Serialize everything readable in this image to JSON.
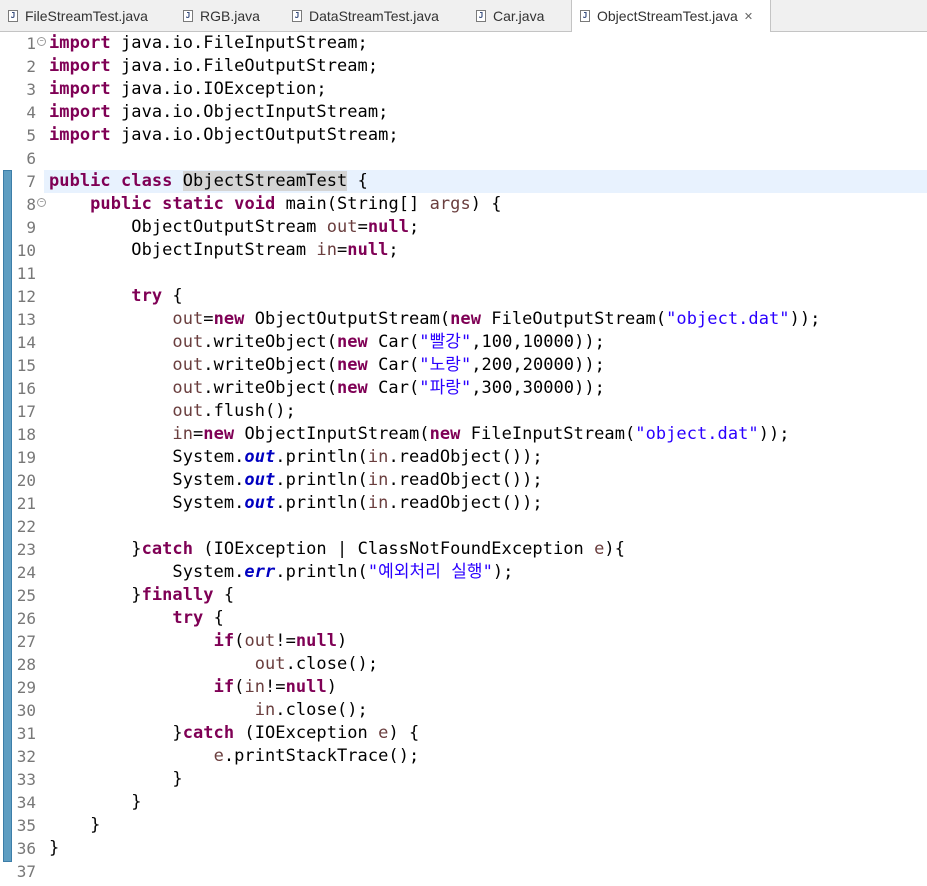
{
  "tabs": [
    {
      "label": "FileStreamTest.java",
      "active": false
    },
    {
      "label": "RGB.java",
      "active": false
    },
    {
      "label": "DataStreamTest.java",
      "active": false
    },
    {
      "label": "Car.java",
      "active": false
    },
    {
      "label": "ObjectStreamTest.java",
      "active": true
    }
  ],
  "colors": {
    "keyword": "#7f0055",
    "string": "#2a00ff",
    "static_field": "#0000c0",
    "local_variable": "#6a3e3e",
    "line_number": "#787878",
    "current_line": "#e8f2fe",
    "ruler": "#5f9ec2"
  },
  "icons": {
    "file_tab": "java-file-icon",
    "close": "close-icon",
    "fold": "fold-collapse-icon"
  },
  "editor": {
    "current_line": 7,
    "fold_markers": [
      1,
      8
    ],
    "lines": [
      [
        {
          "t": "import",
          "c": "kw"
        },
        {
          "t": " java.io.FileInputStream;"
        }
      ],
      [
        {
          "t": "import",
          "c": "kw"
        },
        {
          "t": " java.io.FileOutputStream;"
        }
      ],
      [
        {
          "t": "import",
          "c": "kw"
        },
        {
          "t": " java.io.IOException;"
        }
      ],
      [
        {
          "t": "import",
          "c": "kw"
        },
        {
          "t": " java.io.ObjectInputStream;"
        }
      ],
      [
        {
          "t": "import",
          "c": "kw"
        },
        {
          "t": " java.io.ObjectOutputStream;"
        }
      ],
      [],
      [
        {
          "t": "public",
          "c": "kw"
        },
        {
          "t": " "
        },
        {
          "t": "class",
          "c": "kw"
        },
        {
          "t": " "
        },
        {
          "t": "ObjectStreamTest",
          "c": "hl"
        },
        {
          "t": " {"
        }
      ],
      [
        {
          "t": "    "
        },
        {
          "t": "public",
          "c": "kw"
        },
        {
          "t": " "
        },
        {
          "t": "static",
          "c": "kw"
        },
        {
          "t": " "
        },
        {
          "t": "void",
          "c": "kw"
        },
        {
          "t": " main(String[] "
        },
        {
          "t": "args",
          "c": "var"
        },
        {
          "t": ") {"
        }
      ],
      [
        {
          "t": "        ObjectOutputStream "
        },
        {
          "t": "out",
          "c": "var"
        },
        {
          "t": "="
        },
        {
          "t": "null",
          "c": "kw"
        },
        {
          "t": ";"
        }
      ],
      [
        {
          "t": "        ObjectInputStream "
        },
        {
          "t": "in",
          "c": "var"
        },
        {
          "t": "="
        },
        {
          "t": "null",
          "c": "kw"
        },
        {
          "t": ";"
        }
      ],
      [],
      [
        {
          "t": "        "
        },
        {
          "t": "try",
          "c": "kw"
        },
        {
          "t": " {"
        }
      ],
      [
        {
          "t": "            "
        },
        {
          "t": "out",
          "c": "var"
        },
        {
          "t": "="
        },
        {
          "t": "new",
          "c": "kw"
        },
        {
          "t": " ObjectOutputStream("
        },
        {
          "t": "new",
          "c": "kw"
        },
        {
          "t": " FileOutputStream("
        },
        {
          "t": "\"object.dat\"",
          "c": "str"
        },
        {
          "t": "));"
        }
      ],
      [
        {
          "t": "            "
        },
        {
          "t": "out",
          "c": "var"
        },
        {
          "t": ".writeObject("
        },
        {
          "t": "new",
          "c": "kw"
        },
        {
          "t": " Car("
        },
        {
          "t": "\"빨강\"",
          "c": "str"
        },
        {
          "t": ",100,10000));"
        }
      ],
      [
        {
          "t": "            "
        },
        {
          "t": "out",
          "c": "var"
        },
        {
          "t": ".writeObject("
        },
        {
          "t": "new",
          "c": "kw"
        },
        {
          "t": " Car("
        },
        {
          "t": "\"노랑\"",
          "c": "str"
        },
        {
          "t": ",200,20000));"
        }
      ],
      [
        {
          "t": "            "
        },
        {
          "t": "out",
          "c": "var"
        },
        {
          "t": ".writeObject("
        },
        {
          "t": "new",
          "c": "kw"
        },
        {
          "t": " Car("
        },
        {
          "t": "\"파랑\"",
          "c": "str"
        },
        {
          "t": ",300,30000));"
        }
      ],
      [
        {
          "t": "            "
        },
        {
          "t": "out",
          "c": "var"
        },
        {
          "t": ".flush();"
        }
      ],
      [
        {
          "t": "            "
        },
        {
          "t": "in",
          "c": "var"
        },
        {
          "t": "="
        },
        {
          "t": "new",
          "c": "kw"
        },
        {
          "t": " ObjectInputStream("
        },
        {
          "t": "new",
          "c": "kw"
        },
        {
          "t": " FileInputStream("
        },
        {
          "t": "\"object.dat\"",
          "c": "str"
        },
        {
          "t": "));"
        }
      ],
      [
        {
          "t": "            System."
        },
        {
          "t": "out",
          "c": "fld"
        },
        {
          "t": ".println("
        },
        {
          "t": "in",
          "c": "var"
        },
        {
          "t": ".readObject());"
        }
      ],
      [
        {
          "t": "            System."
        },
        {
          "t": "out",
          "c": "fld"
        },
        {
          "t": ".println("
        },
        {
          "t": "in",
          "c": "var"
        },
        {
          "t": ".readObject());"
        }
      ],
      [
        {
          "t": "            System."
        },
        {
          "t": "out",
          "c": "fld"
        },
        {
          "t": ".println("
        },
        {
          "t": "in",
          "c": "var"
        },
        {
          "t": ".readObject());"
        }
      ],
      [],
      [
        {
          "t": "        }"
        },
        {
          "t": "catch",
          "c": "kw"
        },
        {
          "t": " (IOException | ClassNotFoundException "
        },
        {
          "t": "e",
          "c": "var"
        },
        {
          "t": "){"
        }
      ],
      [
        {
          "t": "            System."
        },
        {
          "t": "err",
          "c": "fld"
        },
        {
          "t": ".println("
        },
        {
          "t": "\"예외처리 실행\"",
          "c": "str"
        },
        {
          "t": ");"
        }
      ],
      [
        {
          "t": "        }"
        },
        {
          "t": "finally",
          "c": "kw"
        },
        {
          "t": " {"
        }
      ],
      [
        {
          "t": "            "
        },
        {
          "t": "try",
          "c": "kw"
        },
        {
          "t": " {"
        }
      ],
      [
        {
          "t": "                "
        },
        {
          "t": "if",
          "c": "kw"
        },
        {
          "t": "("
        },
        {
          "t": "out",
          "c": "var"
        },
        {
          "t": "!="
        },
        {
          "t": "null",
          "c": "kw"
        },
        {
          "t": ")"
        }
      ],
      [
        {
          "t": "                    "
        },
        {
          "t": "out",
          "c": "var"
        },
        {
          "t": ".close();"
        }
      ],
      [
        {
          "t": "                "
        },
        {
          "t": "if",
          "c": "kw"
        },
        {
          "t": "("
        },
        {
          "t": "in",
          "c": "var"
        },
        {
          "t": "!="
        },
        {
          "t": "null",
          "c": "kw"
        },
        {
          "t": ")"
        }
      ],
      [
        {
          "t": "                    "
        },
        {
          "t": "in",
          "c": "var"
        },
        {
          "t": ".close();"
        }
      ],
      [
        {
          "t": "            }"
        },
        {
          "t": "catch",
          "c": "kw"
        },
        {
          "t": " (IOException "
        },
        {
          "t": "e",
          "c": "var"
        },
        {
          "t": ") {"
        }
      ],
      [
        {
          "t": "                "
        },
        {
          "t": "e",
          "c": "var"
        },
        {
          "t": ".printStackTrace();"
        }
      ],
      [
        {
          "t": "            }"
        }
      ],
      [
        {
          "t": "        }"
        }
      ],
      [
        {
          "t": "    }"
        }
      ],
      [
        {
          "t": "}"
        }
      ],
      []
    ]
  }
}
